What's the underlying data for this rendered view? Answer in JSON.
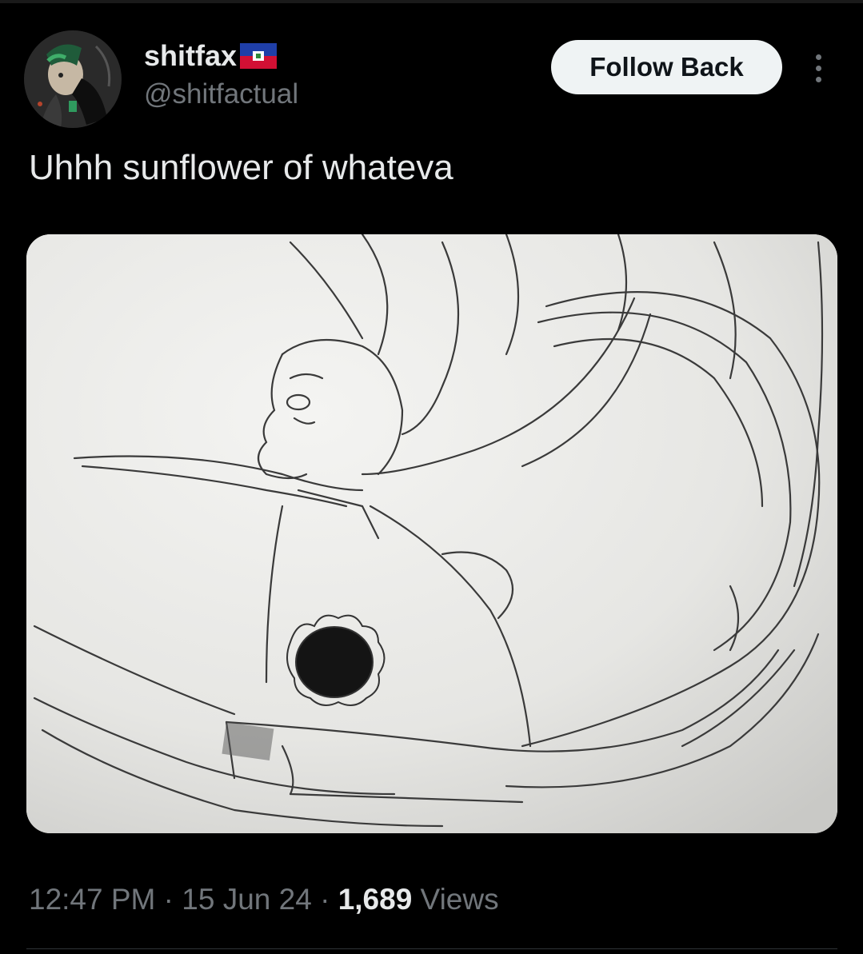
{
  "author": {
    "display_name": "shitfax",
    "flag_emoji": "haiti-flag",
    "handle": "@shitfactual",
    "avatar_icon": "avatar-drawing"
  },
  "actions": {
    "follow_label": "Follow Back",
    "more_icon": "more-vertical-icon"
  },
  "tweet": {
    "text": "Uhhh sunflower of whateva",
    "media_icon": "pencil-sketch-image"
  },
  "meta": {
    "time": "12:47 PM",
    "sep1": " · ",
    "date": "15 Jun 24",
    "sep2": " · ",
    "views_count": "1,689",
    "views_label": " Views"
  },
  "colors": {
    "background": "#000000",
    "text_primary": "#e7e9ea",
    "text_secondary": "#71767b",
    "button_bg": "#eff3f4",
    "button_text": "#0f1419"
  }
}
